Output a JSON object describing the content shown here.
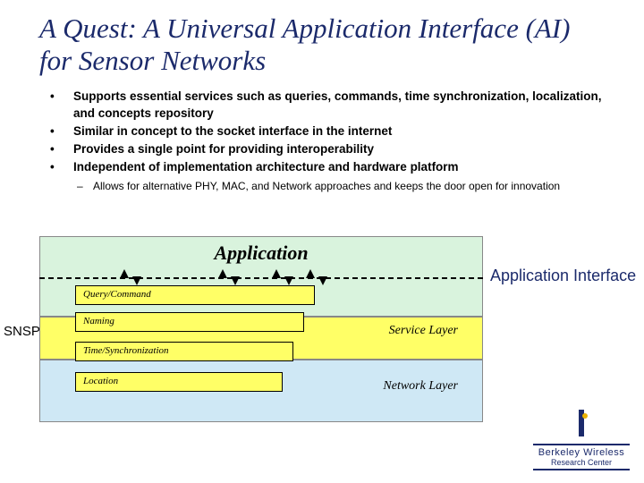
{
  "title": "A Quest: A Universal Application Interface (AI) for Sensor Networks",
  "bullets": [
    "Supports essential services such as queries, commands, time synchronization, localization, and concepts repository",
    "Similar in concept to the socket interface in the internet",
    "Provides a single point for providing interoperability",
    "Independent of implementation architecture and hardware platform"
  ],
  "subbullet": "Allows for alternative PHY, MAC, and Network approaches and keeps the door open for innovation",
  "diagram": {
    "application": "Application",
    "service_layer": "Service Layer",
    "network_layer": "Network Layer",
    "boxes": {
      "query_command": "Query/Command",
      "naming": "Naming",
      "time_sync": "Time/Synchronization",
      "location": "Location"
    }
  },
  "side": {
    "snsp": "SNSP",
    "ai_label": "Application Interface"
  },
  "logo": {
    "line1": "Berkeley Wireless",
    "line2": "Research Center"
  }
}
